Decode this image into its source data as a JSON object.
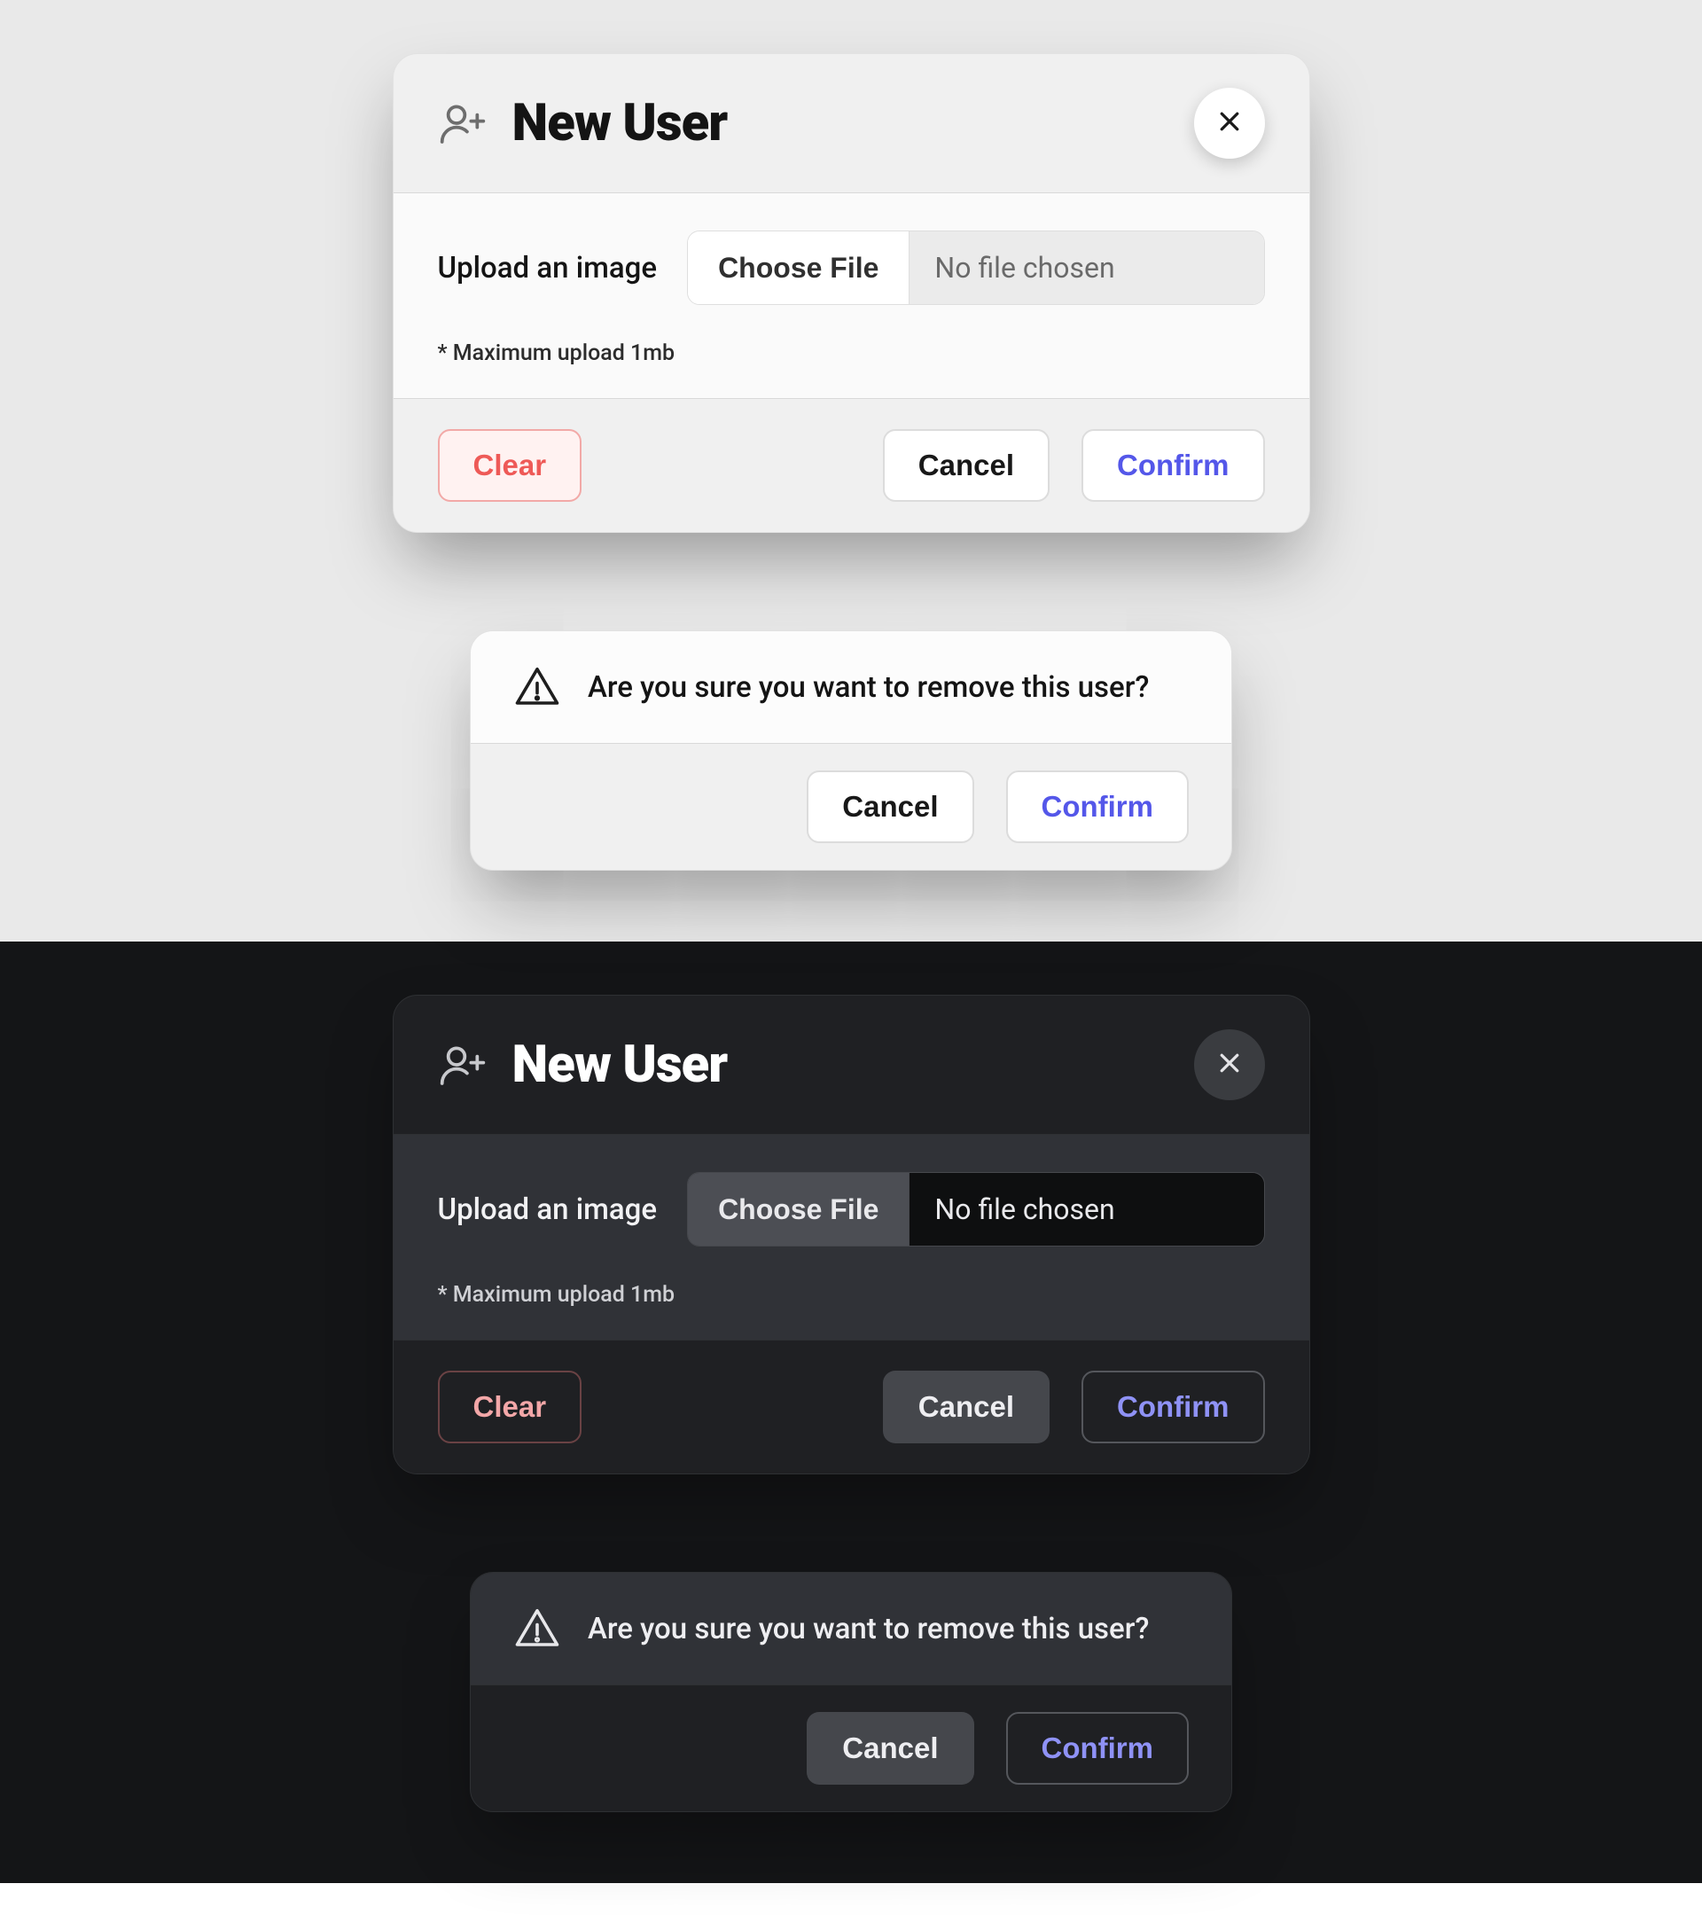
{
  "new_user": {
    "title": "New User",
    "upload_label": "Upload an image",
    "choose_label": "Choose File",
    "file_status": "No file chosen",
    "hint": "* Maximum upload 1mb",
    "buttons": {
      "clear": "Clear",
      "cancel": "Cancel",
      "confirm": "Confirm"
    }
  },
  "confirm_dialog": {
    "message": "Are you sure you want to remove this user?",
    "buttons": {
      "cancel": "Cancel",
      "confirm": "Confirm"
    }
  },
  "icons": {
    "add_user": "user-plus-icon",
    "close": "close-icon",
    "warning": "warning-triangle-icon"
  },
  "colors": {
    "accent": "#5457e9",
    "danger": "#ee5a57",
    "light_bg": "#e9e9e9",
    "dark_bg": "#141517"
  }
}
